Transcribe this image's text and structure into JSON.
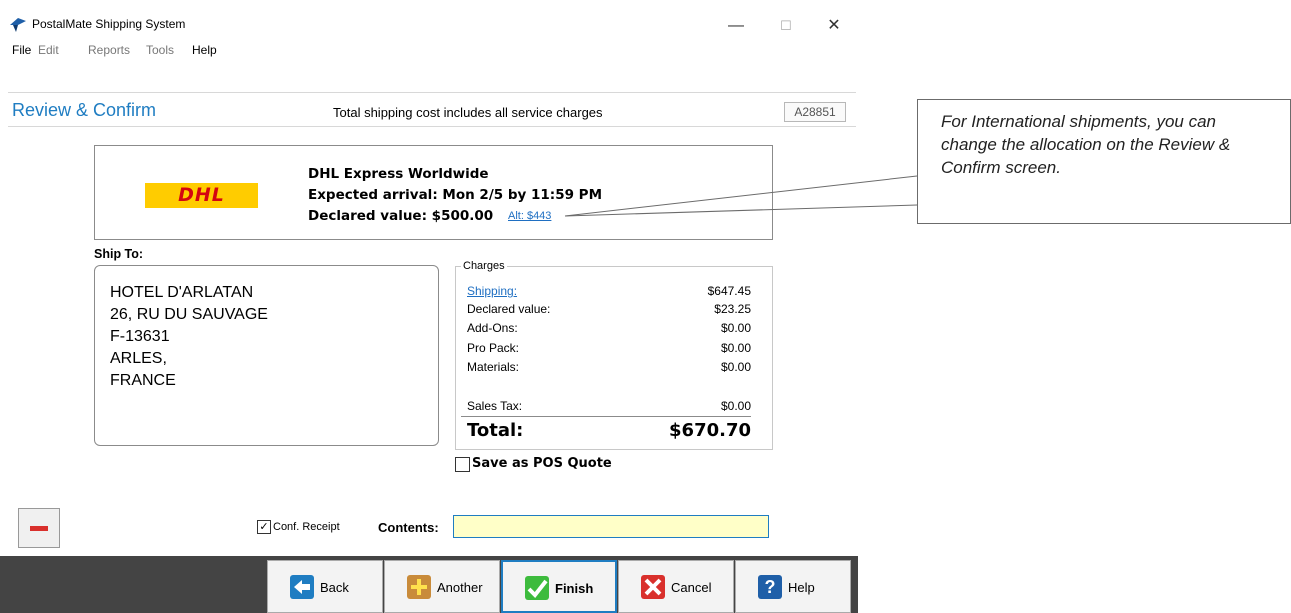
{
  "window": {
    "title": "PostalMate Shipping System",
    "controls": {
      "minimize": "—",
      "maximize": "☐",
      "close": "✕"
    }
  },
  "menu": [
    "File",
    "Edit",
    "Reports",
    "Tools",
    "Help"
  ],
  "header": {
    "title": "Review & Confirm",
    "note": "Total shipping cost includes all service charges",
    "code": "A28851"
  },
  "carrier": {
    "logo_text": "DHL",
    "service": "DHL Express Worldwide",
    "arrival": "Expected arrival: Mon  2/5 by 11:59 PM",
    "declared": "Declared value: $500.00",
    "alt_link": "Alt: $443"
  },
  "ship_to": {
    "label": "Ship To:",
    "lines": [
      "HOTEL D'ARLATAN",
      "26, RU DU SAUVAGE",
      "F-13631",
      "ARLES,",
      "FRANCE"
    ]
  },
  "charges": {
    "legend": "Charges",
    "rows": [
      {
        "label": "Shipping:",
        "value": "$647.45"
      },
      {
        "label": "Declared value:",
        "value": "$23.25"
      },
      {
        "label": "Add-Ons:",
        "value": "$0.00"
      },
      {
        "label": "Pro Pack:",
        "value": "$0.00"
      },
      {
        "label": "Materials:",
        "value": "$0.00"
      }
    ],
    "sales_tax": {
      "label": "Sales Tax:",
      "value": "$0.00"
    },
    "total": {
      "label": "Total:",
      "value": "$670.70"
    }
  },
  "pos_quote": {
    "label": "Save as POS Quote",
    "checked": false
  },
  "conf_receipt": {
    "label": "Conf. Receipt",
    "checked": true
  },
  "contents": {
    "label": "Contents:",
    "value": ""
  },
  "footer_buttons": [
    {
      "label": "Back",
      "icon": "back-arrow-icon"
    },
    {
      "label": "Another",
      "icon": "add-package-icon"
    },
    {
      "label": "Finish",
      "icon": "checkmark-icon"
    },
    {
      "label": "Cancel",
      "icon": "x-icon"
    },
    {
      "label": "Help",
      "icon": "question-icon"
    }
  ],
  "callout": {
    "text": "For International shipments, you can change the allocation on the Review & Confirm screen."
  },
  "colors": {
    "accent": "#1f7dc2",
    "dhl_yellow": "#ffcc00",
    "dhl_red": "#d40511",
    "footer": "#444444"
  }
}
